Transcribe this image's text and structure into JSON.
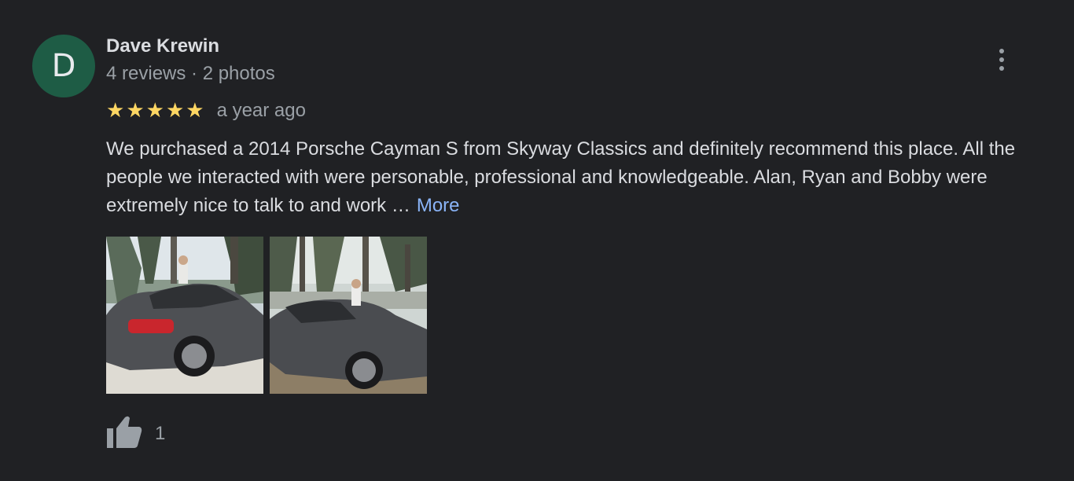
{
  "review": {
    "author": {
      "initial": "D",
      "name": "Dave Krewin",
      "meta": "4 reviews · 2 photos",
      "avatar_color": "#1e5c45"
    },
    "rating": 5,
    "stars": [
      "★",
      "★",
      "★",
      "★",
      "★"
    ],
    "star_color": "#fdd663",
    "date": "a year ago",
    "text": "We purchased a 2014 Porsche Cayman S from Skyway Classics and definitely recommend this place.  All the people we interacted with were personable, professional and knowledgeable.  Alan, Ryan and Bobby were extremely nice to talk to and work …",
    "more_label": "More",
    "more_options_icon": "more-vert-icon",
    "like_icon": "thumb-up-icon",
    "like_count": "1",
    "link_color": "#8ab4f8"
  }
}
